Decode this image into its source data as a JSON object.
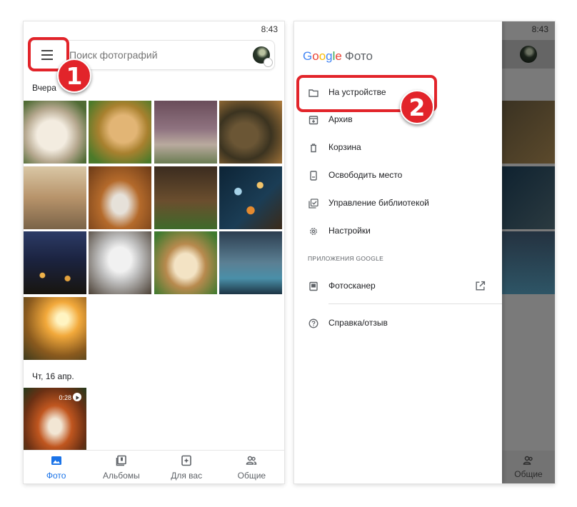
{
  "status": {
    "time": "8:43"
  },
  "search": {
    "placeholder": "Поиск фотографий"
  },
  "gallery": {
    "section_yesterday": "Вчера",
    "section_date": "Чт, 16 апр.",
    "video_duration": "0:28"
  },
  "bottom_nav": {
    "items": [
      {
        "label": "Фото",
        "icon": "photo-icon",
        "active": true
      },
      {
        "label": "Альбомы",
        "icon": "albums-icon",
        "active": false
      },
      {
        "label": "Для вас",
        "icon": "for-you-icon",
        "active": false
      },
      {
        "label": "Общие",
        "icon": "sharing-icon",
        "active": false
      }
    ]
  },
  "drawer": {
    "brand": {
      "letters": [
        "G",
        "o",
        "o",
        "g",
        "l",
        "e"
      ],
      "product": "Фото"
    },
    "items": [
      {
        "label": "На устройстве",
        "icon": "folder-icon"
      },
      {
        "label": "Архив",
        "icon": "archive-icon"
      },
      {
        "label": "Корзина",
        "icon": "trash-icon"
      },
      {
        "label": "Освободить место",
        "icon": "phone-clean-icon"
      },
      {
        "label": "Управление библиотекой",
        "icon": "library-check-icon"
      },
      {
        "label": "Настройки",
        "icon": "settings-icon"
      }
    ],
    "apps_header": "ПРИЛОЖЕНИЯ GOOGLE",
    "apps": [
      {
        "label": "Фотосканер",
        "icon": "photoscan-icon",
        "external_icon": "open-external-icon"
      }
    ],
    "help": {
      "label": "Справка/отзыв",
      "icon": "help-icon"
    }
  },
  "callouts": {
    "step1": "1",
    "step2": "2"
  },
  "colors": {
    "accent": "#1a73e8",
    "callout": "#e2242a"
  }
}
